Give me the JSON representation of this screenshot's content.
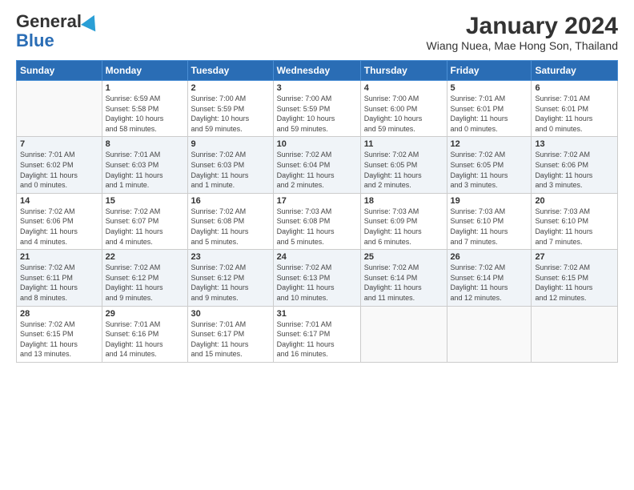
{
  "logo": {
    "general": "General",
    "blue": "Blue"
  },
  "title": "January 2024",
  "subtitle": "Wiang Nuea, Mae Hong Son, Thailand",
  "days_of_week": [
    "Sunday",
    "Monday",
    "Tuesday",
    "Wednesday",
    "Thursday",
    "Friday",
    "Saturday"
  ],
  "weeks": [
    [
      {
        "day": "",
        "info": ""
      },
      {
        "day": "1",
        "info": "Sunrise: 6:59 AM\nSunset: 5:58 PM\nDaylight: 10 hours\nand 58 minutes."
      },
      {
        "day": "2",
        "info": "Sunrise: 7:00 AM\nSunset: 5:59 PM\nDaylight: 10 hours\nand 59 minutes."
      },
      {
        "day": "3",
        "info": "Sunrise: 7:00 AM\nSunset: 5:59 PM\nDaylight: 10 hours\nand 59 minutes."
      },
      {
        "day": "4",
        "info": "Sunrise: 7:00 AM\nSunset: 6:00 PM\nDaylight: 10 hours\nand 59 minutes."
      },
      {
        "day": "5",
        "info": "Sunrise: 7:01 AM\nSunset: 6:01 PM\nDaylight: 11 hours\nand 0 minutes."
      },
      {
        "day": "6",
        "info": "Sunrise: 7:01 AM\nSunset: 6:01 PM\nDaylight: 11 hours\nand 0 minutes."
      }
    ],
    [
      {
        "day": "7",
        "info": "Sunrise: 7:01 AM\nSunset: 6:02 PM\nDaylight: 11 hours\nand 0 minutes."
      },
      {
        "day": "8",
        "info": "Sunrise: 7:01 AM\nSunset: 6:03 PM\nDaylight: 11 hours\nand 1 minute."
      },
      {
        "day": "9",
        "info": "Sunrise: 7:02 AM\nSunset: 6:03 PM\nDaylight: 11 hours\nand 1 minute."
      },
      {
        "day": "10",
        "info": "Sunrise: 7:02 AM\nSunset: 6:04 PM\nDaylight: 11 hours\nand 2 minutes."
      },
      {
        "day": "11",
        "info": "Sunrise: 7:02 AM\nSunset: 6:05 PM\nDaylight: 11 hours\nand 2 minutes."
      },
      {
        "day": "12",
        "info": "Sunrise: 7:02 AM\nSunset: 6:05 PM\nDaylight: 11 hours\nand 3 minutes."
      },
      {
        "day": "13",
        "info": "Sunrise: 7:02 AM\nSunset: 6:06 PM\nDaylight: 11 hours\nand 3 minutes."
      }
    ],
    [
      {
        "day": "14",
        "info": "Sunrise: 7:02 AM\nSunset: 6:06 PM\nDaylight: 11 hours\nand 4 minutes."
      },
      {
        "day": "15",
        "info": "Sunrise: 7:02 AM\nSunset: 6:07 PM\nDaylight: 11 hours\nand 4 minutes."
      },
      {
        "day": "16",
        "info": "Sunrise: 7:02 AM\nSunset: 6:08 PM\nDaylight: 11 hours\nand 5 minutes."
      },
      {
        "day": "17",
        "info": "Sunrise: 7:03 AM\nSunset: 6:08 PM\nDaylight: 11 hours\nand 5 minutes."
      },
      {
        "day": "18",
        "info": "Sunrise: 7:03 AM\nSunset: 6:09 PM\nDaylight: 11 hours\nand 6 minutes."
      },
      {
        "day": "19",
        "info": "Sunrise: 7:03 AM\nSunset: 6:10 PM\nDaylight: 11 hours\nand 7 minutes."
      },
      {
        "day": "20",
        "info": "Sunrise: 7:03 AM\nSunset: 6:10 PM\nDaylight: 11 hours\nand 7 minutes."
      }
    ],
    [
      {
        "day": "21",
        "info": "Sunrise: 7:02 AM\nSunset: 6:11 PM\nDaylight: 11 hours\nand 8 minutes."
      },
      {
        "day": "22",
        "info": "Sunrise: 7:02 AM\nSunset: 6:12 PM\nDaylight: 11 hours\nand 9 minutes."
      },
      {
        "day": "23",
        "info": "Sunrise: 7:02 AM\nSunset: 6:12 PM\nDaylight: 11 hours\nand 9 minutes."
      },
      {
        "day": "24",
        "info": "Sunrise: 7:02 AM\nSunset: 6:13 PM\nDaylight: 11 hours\nand 10 minutes."
      },
      {
        "day": "25",
        "info": "Sunrise: 7:02 AM\nSunset: 6:14 PM\nDaylight: 11 hours\nand 11 minutes."
      },
      {
        "day": "26",
        "info": "Sunrise: 7:02 AM\nSunset: 6:14 PM\nDaylight: 11 hours\nand 12 minutes."
      },
      {
        "day": "27",
        "info": "Sunrise: 7:02 AM\nSunset: 6:15 PM\nDaylight: 11 hours\nand 12 minutes."
      }
    ],
    [
      {
        "day": "28",
        "info": "Sunrise: 7:02 AM\nSunset: 6:15 PM\nDaylight: 11 hours\nand 13 minutes."
      },
      {
        "day": "29",
        "info": "Sunrise: 7:01 AM\nSunset: 6:16 PM\nDaylight: 11 hours\nand 14 minutes."
      },
      {
        "day": "30",
        "info": "Sunrise: 7:01 AM\nSunset: 6:17 PM\nDaylight: 11 hours\nand 15 minutes."
      },
      {
        "day": "31",
        "info": "Sunrise: 7:01 AM\nSunset: 6:17 PM\nDaylight: 11 hours\nand 16 minutes."
      },
      {
        "day": "",
        "info": ""
      },
      {
        "day": "",
        "info": ""
      },
      {
        "day": "",
        "info": ""
      }
    ]
  ]
}
